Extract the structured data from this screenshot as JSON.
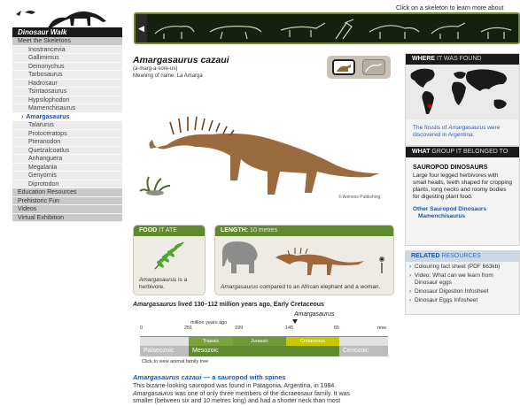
{
  "site": {
    "logo_text": "Dinosaur Walk"
  },
  "sidebar": {
    "heading": "Meet the Skeletons",
    "items": [
      {
        "label": "Inostrancevia"
      },
      {
        "label": "Gallimimus"
      },
      {
        "label": "Deinonychus"
      },
      {
        "label": "Tarbosaurus"
      },
      {
        "label": "Hadrosaur"
      },
      {
        "label": "Tsintaosaurus"
      },
      {
        "label": "Hypsilophodon"
      },
      {
        "label": "Mamenchisaurus"
      },
      {
        "label": "Amargasaurus",
        "active": true
      },
      {
        "label": "Talarurus"
      },
      {
        "label": "Protoceratops"
      },
      {
        "label": "Pteranodon"
      },
      {
        "label": "Quetzalcoatlus"
      },
      {
        "label": "Anhanguera"
      },
      {
        "label": "Megalania"
      },
      {
        "label": "Genyornis"
      },
      {
        "label": "Diprotodon"
      }
    ],
    "sections": [
      {
        "label": "Education Resources"
      },
      {
        "label": "Prehistoric Fun"
      },
      {
        "label": "Videos"
      },
      {
        "label": "Virtual Exhibition"
      }
    ]
  },
  "strip": {
    "hint": "Click on a skeleton to learn more about"
  },
  "main": {
    "title": "Amargasaurus cazaui",
    "pronunciation": "(a-marg-a-sore-us)",
    "meaning": "Meaning of name: La Amarga",
    "credit": "© Amness Publishing",
    "food": {
      "head_bold": "FOOD",
      "head_light": " IT ATE",
      "text_name": "Amargasaurus",
      "text_rest": " is a herbivore."
    },
    "length": {
      "head_bold": "LENGTH:",
      "head_light": " 10 metres",
      "text_name": "Amargasaurus",
      "text_rest": " compared to an African elephant and a woman."
    },
    "lived": {
      "name": "Amargasaurus",
      "rest": " lived 130–112 million years ago, Early Cretaceous"
    },
    "timeline": {
      "label": "Amargasaurus",
      "ticks": [
        "0",
        "251",
        "million years ago",
        "199",
        "145",
        "65",
        "now"
      ],
      "periods": [
        "Triassic",
        "Jurassic",
        "Cretaceous"
      ],
      "eras": [
        "Palaeozoic",
        "Mesozoic",
        "Cenozoic"
      ],
      "click_text": "Click to view animal family tree"
    },
    "sub_head": {
      "name": "Amargasaurus cazaui",
      "rest": " — a sauropod with spines"
    },
    "body": {
      "line1": "This bizarre-looking sauropod was found in Patagonia, Argentina, in 1984.",
      "line2_name": "Amargasaurus",
      "line2_rest": " was one of only three members of the dicraeosaur family. It was",
      "line3": "smaller (between six and 10 metres long) and had a shorter neck than most"
    }
  },
  "right": {
    "where": {
      "head_bold": "WHERE",
      "head_light": " IT WAS FOUND",
      "caption_a": "The fossils of ",
      "caption_name": "Amargasaurus",
      "caption_b": " were discovered in Argentina."
    },
    "group": {
      "head_bold": "WHAT",
      "head_light": " GROUP IT BELONGED TO",
      "title": "SAUROPOD DINOSAURS",
      "text": "Large four legged herbivores with small heads, teeth shaped for cropping plants, long necks and roomy bodies for digesting plant food.",
      "other_title": "Other Sauropod Dinosaurs",
      "other_link": "Mamenchisaurus"
    },
    "related": {
      "head_bold": "RELATED",
      "head_light": " RESOURCES",
      "items": [
        {
          "label": "Colouring fact sheet (PDF 663kb)"
        },
        {
          "label": "Video: What can we learn from Dinosaur eggs"
        },
        {
          "label": "Dinosaur Digestion Infosheet"
        },
        {
          "label": "Dinosaur Eggs Infosheet"
        }
      ]
    }
  },
  "colors": {
    "accent_green": "#5f8a2e",
    "link_blue": "#1b56a8",
    "timeline_highlight": "#c8c800"
  }
}
